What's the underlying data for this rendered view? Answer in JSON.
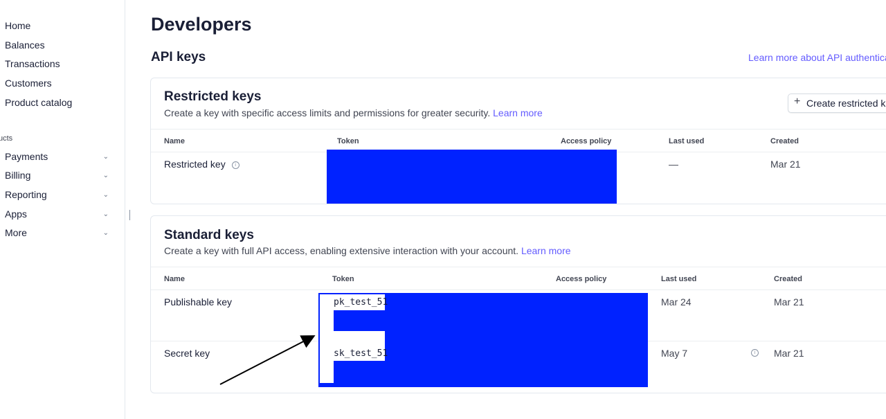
{
  "sidebar": {
    "items": [
      {
        "label": "Home"
      },
      {
        "label": "Balances"
      },
      {
        "label": "Transactions"
      },
      {
        "label": "Customers"
      },
      {
        "label": "Product catalog"
      }
    ],
    "section_label": "ucts",
    "product_items": [
      {
        "label": "Payments"
      },
      {
        "label": "Billing"
      },
      {
        "label": "Reporting"
      },
      {
        "label": "Apps"
      },
      {
        "label": "More"
      }
    ]
  },
  "page": {
    "title": "Developers",
    "subtitle": "API keys",
    "learn_more_link": "Learn more about API authentica"
  },
  "restricted": {
    "title": "Restricted keys",
    "description": "Create a key with specific access limits and permissions for greater security.",
    "learn_more": "Learn more",
    "create_button": "Create restricted ke",
    "columns": [
      "Name",
      "Token",
      "Access policy",
      "Last used",
      "Created"
    ],
    "rows": [
      {
        "name": "Restricted key",
        "last_used": "—",
        "created": "Mar 21"
      }
    ]
  },
  "standard": {
    "title": "Standard keys",
    "description": "Create a key with full API access, enabling extensive interaction with your account.",
    "learn_more": "Learn more",
    "columns": [
      "Name",
      "Token",
      "Access policy",
      "Last used",
      "Created"
    ],
    "rows": [
      {
        "name": "Publishable key",
        "token_prefix": "pk_test_51",
        "last_used": "Mar 24",
        "created": "Mar 21"
      },
      {
        "name": "Secret key",
        "token_prefix": "sk_test_51",
        "last_used": "May 7",
        "created": "Mar 21"
      }
    ]
  },
  "colors": {
    "accent": "#635bff",
    "redaction": "#0022ff"
  },
  "icons": [
    "chevron-down-icon",
    "info-icon",
    "plus-icon"
  ]
}
